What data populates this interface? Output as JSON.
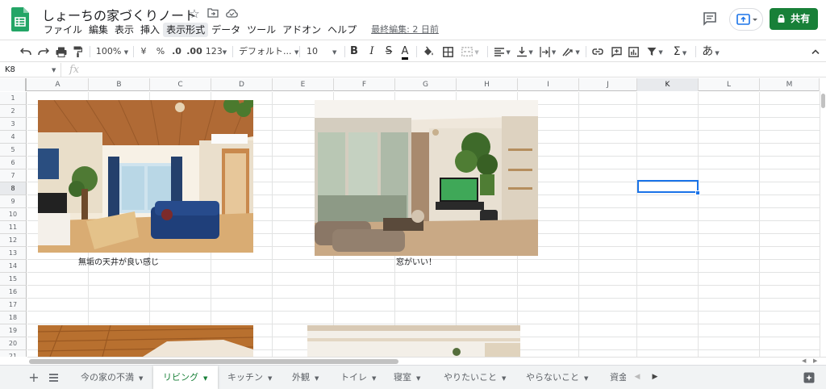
{
  "app": {
    "title": "しょーちの家づくりノート",
    "share_label": "共有",
    "accent": "#188038",
    "selection_color": "#1a73e8"
  },
  "menu": {
    "items": [
      "ファイル",
      "編集",
      "表示",
      "挿入",
      "表示形式",
      "データ",
      "ツール",
      "アドオン",
      "ヘルプ"
    ],
    "last_edit": "最終編集: 2 日前"
  },
  "toolbar": {
    "zoom": "100%",
    "currency": "¥",
    "percent": "%",
    "dec_less": ".0",
    "dec_more": ".00",
    "number_format": "123",
    "font": "デフォルト...",
    "font_size": "10",
    "bold": "B",
    "italic": "I",
    "strike": "S",
    "text_color": "A",
    "sigma": "Σ",
    "input_mode": "あ"
  },
  "formula_bar": {
    "cell_ref": "K8",
    "fx": "fx"
  },
  "grid": {
    "columns": [
      "A",
      "B",
      "C",
      "D",
      "E",
      "F",
      "G",
      "H",
      "I",
      "J",
      "K",
      "L",
      "M"
    ],
    "rows": [
      "1",
      "2",
      "3",
      "4",
      "5",
      "6",
      "7",
      "8",
      "9",
      "10",
      "11",
      "12",
      "13",
      "14",
      "15",
      "16",
      "17",
      "18",
      "19",
      "20",
      "21"
    ],
    "selected_col": "K",
    "selected_row": "8",
    "captions": {
      "living1": "無垢の天井が良い感じ",
      "living2": "窓がいい！"
    }
  },
  "tabs": [
    {
      "label": "今の家の不満"
    },
    {
      "label": "リビング",
      "active": true
    },
    {
      "label": "キッチン"
    },
    {
      "label": "外観"
    },
    {
      "label": "トイレ"
    },
    {
      "label": "寝室"
    },
    {
      "label": "やりたいこと"
    },
    {
      "label": "やらないこと"
    },
    {
      "label": "資金"
    }
  ],
  "icons": [
    "sheets-logo-icon",
    "star-icon",
    "move-folder-icon",
    "cloud-status-icon",
    "comment-icon",
    "present-icon",
    "lock-icon",
    "undo-icon",
    "redo-icon",
    "print-icon",
    "paint-format-icon",
    "fill-color-icon",
    "borders-icon",
    "merge-icon",
    "align-icon",
    "valign-icon",
    "wrap-icon",
    "rotate-icon",
    "link-icon",
    "insert-comment-icon",
    "insert-chart-icon",
    "filter-icon",
    "collapse-icon",
    "add-sheet-icon",
    "all-sheets-icon",
    "explore-icon"
  ]
}
